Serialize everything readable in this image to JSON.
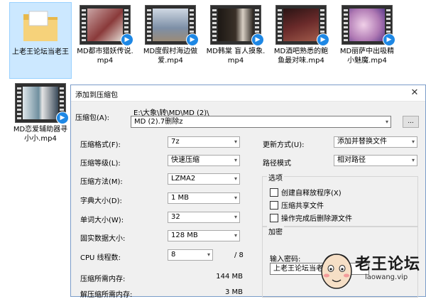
{
  "files": [
    {
      "name": "上老王论坛当老王",
      "kind": "folder",
      "selected": true
    },
    {
      "name": "MD都市猎妖传说.mp4",
      "kind": "video",
      "frame_color": "#8a3a3a"
    },
    {
      "name": "MD度假村海边做爱.mp4",
      "kind": "video",
      "frame_color": "#7d8fa6"
    },
    {
      "name": "MD韩棠 盲人摸象.mp4",
      "kind": "video",
      "frame_color": "#3a3028"
    },
    {
      "name": "MD酒吧熟悉的鲍鱼最对味.mp4",
      "kind": "video",
      "frame_color": "#6a2a2a"
    },
    {
      "name": "MD丽萨中出吸精小魅魔.mp4",
      "kind": "video",
      "frame_color": "#b07ab4"
    },
    {
      "name": "MD恋爱辅助器寻小小.mp4",
      "kind": "video",
      "frame_color": "#6f8f9f"
    }
  ],
  "dialog": {
    "title": "添加到压缩包",
    "archive_label": "压缩包(A):",
    "archive_path": "E:\\大象\\转\\MD\\MD (2)\\",
    "archive_name": "MD (2).7删除z",
    "browse_label": "...",
    "left_fields": [
      {
        "label": "压缩格式(F):",
        "value": "7z"
      },
      {
        "label": "压缩等级(L):",
        "value": "快速压缩"
      },
      {
        "label": "压缩方法(M):",
        "value": "LZMA2"
      },
      {
        "label": "字典大小(D):",
        "value": "1 MB"
      },
      {
        "label": "单词大小(W):",
        "value": "32"
      },
      {
        "label": "固实数据大小:",
        "value": "128 MB"
      }
    ],
    "cpu_label": "CPU 线程数:",
    "cpu_value": "8",
    "cpu_total": "/ 8",
    "mem_compress_label": "压缩所需内存:",
    "mem_compress_value": "144 MB",
    "mem_decompress_label": "解压缩所需内存:",
    "mem_decompress_value": "3 MB",
    "update_label": "更新方式(U):",
    "update_value": "添加并替换文件",
    "path_label": "路径模式",
    "path_value": "相对路径",
    "options_title": "选项",
    "options": [
      {
        "label": "创建自释放程序(X)",
        "checked": false
      },
      {
        "label": "压缩共享文件",
        "checked": false
      },
      {
        "label": "操作完成后删除源文件",
        "checked": false
      }
    ],
    "encrypt_title": "加密",
    "password_label": "输入密码:",
    "password_value": "上老王论坛当老"
  },
  "watermark": {
    "title": "老王论坛",
    "url": "laowang.vip"
  },
  "colors": {
    "selection_bg": "#cce8ff",
    "dialog_bg": "#f0f0f0",
    "badge_blue": "#1e88e5"
  }
}
